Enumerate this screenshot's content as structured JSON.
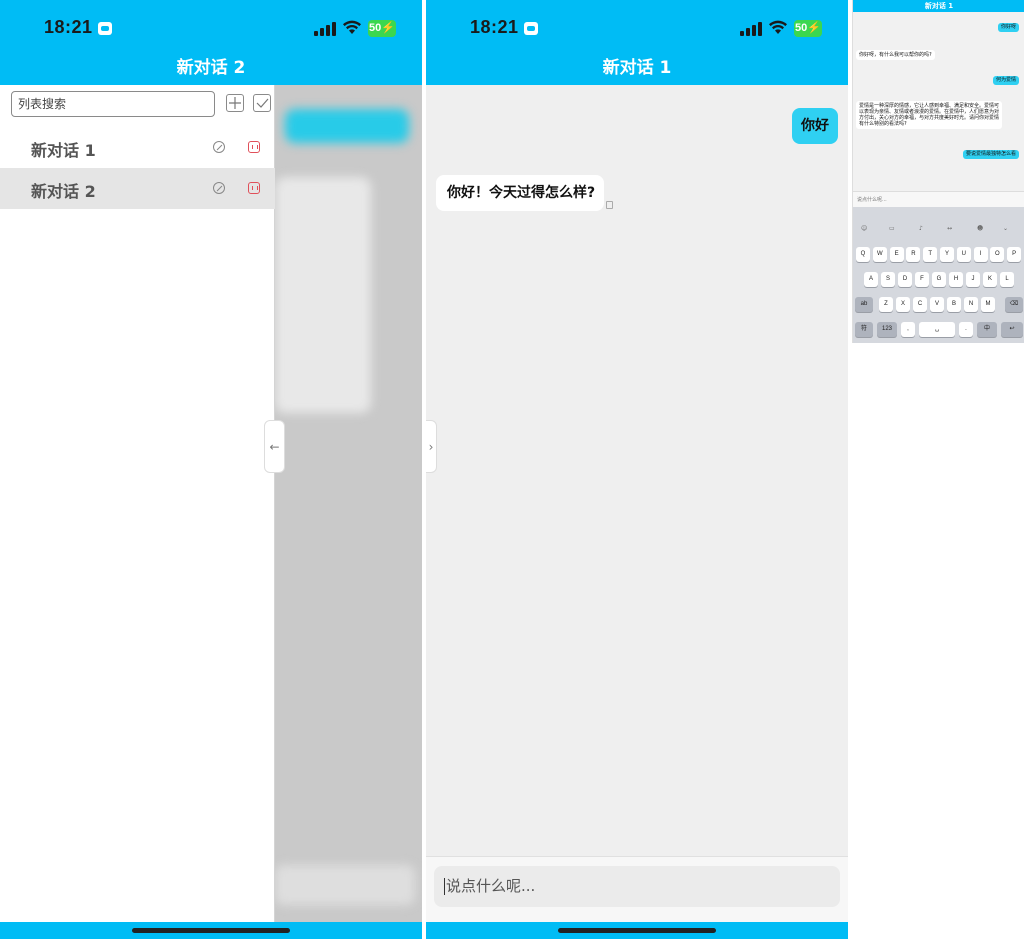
{
  "status": {
    "time": "18:21",
    "battery": "50"
  },
  "phone1": {
    "title": "新对话 2",
    "search_placeholder": "列表搜索",
    "conversations": [
      {
        "label": "新对话 1",
        "active": false
      },
      {
        "label": "新对话 2",
        "active": true
      }
    ]
  },
  "phone2": {
    "title": "新对话 1",
    "messages": [
      {
        "role": "user",
        "text": "你好"
      },
      {
        "role": "assistant",
        "text": "你好！今天过得怎么样?"
      }
    ],
    "input_placeholder": "说点什么呢..."
  },
  "phone3": {
    "title": "新对话 1",
    "messages": [
      {
        "role": "user",
        "text": "你好呀"
      },
      {
        "role": "assistant",
        "text": "你好呀，有什么我可以帮你的吗?"
      },
      {
        "role": "user",
        "text": "何为爱情"
      },
      {
        "role": "assistant",
        "text": "爱情是一种深厚的情感，它让人感到幸福、满足和安全。爱情可以表现为亲情、友情或者浪漫的爱情。在爱情中，人们愿意为对方付出，关心对方的幸福，与对方共度美好时光。请问你对爱情有什么特别的看法吗?"
      },
      {
        "role": "user",
        "text": "要说爱情最独特怎么看"
      }
    ],
    "input_placeholder": "说点什么呢...",
    "keyboard": {
      "row1": [
        "Q",
        "W",
        "E",
        "R",
        "T",
        "Y",
        "U",
        "I",
        "O",
        "P"
      ],
      "row2": [
        "A",
        "S",
        "D",
        "F",
        "G",
        "H",
        "J",
        "K",
        "L"
      ],
      "row3": [
        "Z",
        "X",
        "C",
        "V",
        "B",
        "N",
        "M"
      ],
      "shift_label": "ab",
      "num_label": "123",
      "lang_label": "中",
      "return_label": "↩"
    }
  }
}
